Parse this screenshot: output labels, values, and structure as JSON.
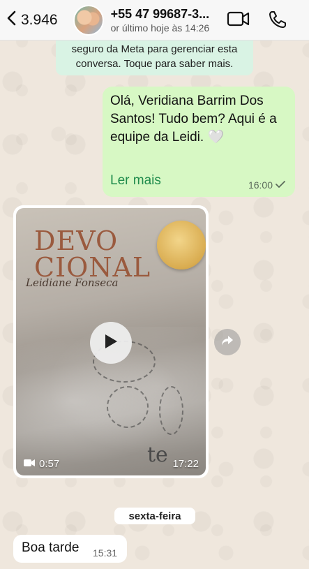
{
  "header": {
    "back_count": "3.946",
    "contact_name": "+55 47 99687-3...",
    "contact_status": "or último hoje às 14:26",
    "icons": [
      "chevron-left-icon",
      "video-call-icon",
      "phone-call-icon"
    ]
  },
  "notice": {
    "line1": "seguro da Meta para gerenciar esta",
    "line2": "conversa. Toque para saber mais."
  },
  "outgoing_message": {
    "text": "Olá, Veridiana Barrim Dos Santos! Tudo bem? Aqui é a equipe da Leidi. 🤍",
    "read_more": "Ler mais",
    "time": "16:00"
  },
  "video_message": {
    "book_title_line1": "DEVO",
    "book_title_line2": "CIONAL",
    "author": "Leidiane Fonseca",
    "duration": "0:57",
    "time": "17:22",
    "overlay_text": "te"
  },
  "date_separator": "sexta-feira",
  "incoming_message": {
    "text": "Boa tarde",
    "time": "15:31"
  },
  "colors": {
    "outgoing_bubble": "#d7f8c4",
    "notice_bubble": "#d9f3e4",
    "read_more_link": "#1f8b4c",
    "wallpaper": "#efe7dd"
  }
}
